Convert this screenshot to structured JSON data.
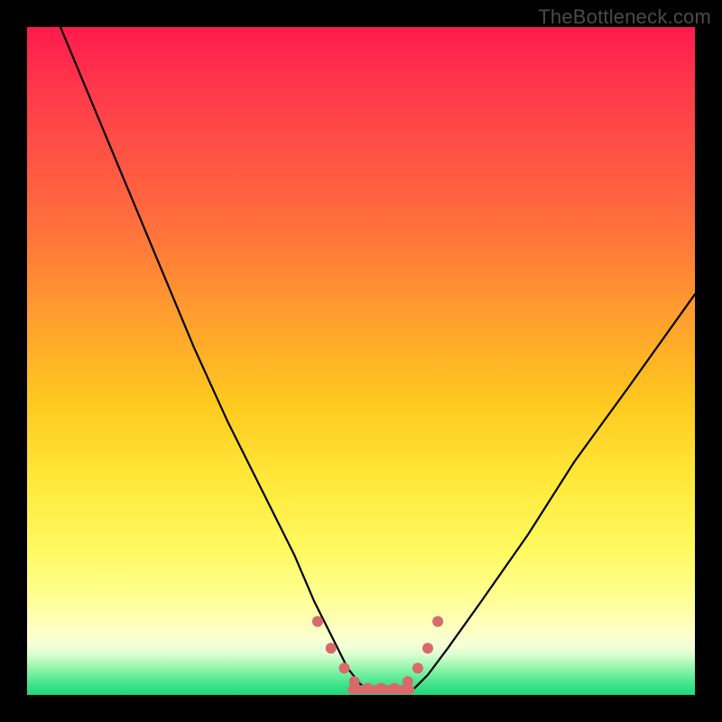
{
  "watermark": "TheBottleneck.com",
  "chart_data": {
    "type": "line",
    "title": "",
    "xlabel": "",
    "ylabel": "",
    "xlim": [
      0,
      100
    ],
    "ylim": [
      0,
      100
    ],
    "series": [
      {
        "name": "bottleneck-curve",
        "x": [
          5,
          10,
          15,
          20,
          25,
          30,
          35,
          40,
          43,
          46,
          48,
          50,
          52,
          54,
          56,
          58,
          60,
          63,
          68,
          75,
          82,
          90,
          100
        ],
        "y": [
          100,
          88,
          76,
          64,
          52,
          41,
          31,
          21,
          14,
          8,
          4,
          1.5,
          0.5,
          0.5,
          0.5,
          1,
          3,
          7,
          14,
          24,
          35,
          46,
          60
        ]
      }
    ],
    "markers": {
      "name": "highlight-dots",
      "color": "#d86a6a",
      "x": [
        43.5,
        45.5,
        47.5,
        49,
        51,
        53,
        55,
        57,
        58.5,
        60,
        61.5
      ],
      "y": [
        11,
        7,
        4,
        2,
        1,
        1,
        1,
        2,
        4,
        7,
        11
      ]
    },
    "flat_segment": {
      "name": "bottom-bar",
      "color": "#d86a6a",
      "x_start": 48,
      "x_end": 58,
      "y": 0.8
    }
  }
}
